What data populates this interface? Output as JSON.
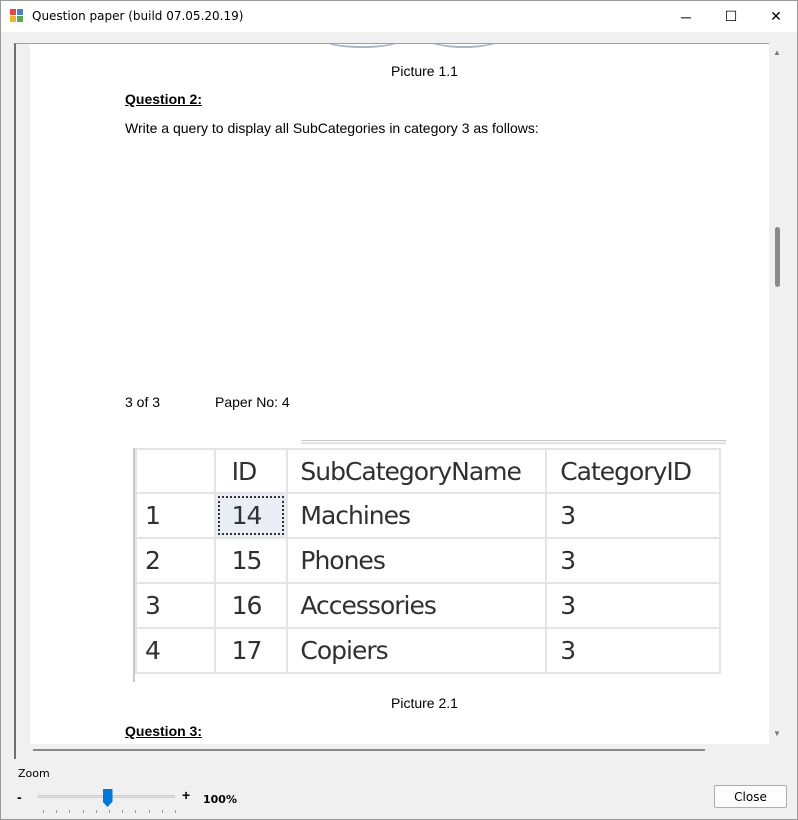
{
  "window": {
    "title": "Question paper (build 07.05.20.19)",
    "minimize_glyph": "─",
    "maximize_glyph": "☐",
    "close_glyph": "✕"
  },
  "document": {
    "picture1_caption": "Picture 1.1",
    "question2_heading": "Question 2:",
    "question2_text": "Write a query to display all SubCategories in category 3 as follows:",
    "page_counter": "3 of 3",
    "paper_no": "Paper No: 4",
    "result_grid": {
      "columns": [
        "",
        "ID",
        "SubCategoryName",
        "CategoryID"
      ],
      "rows": [
        [
          "1",
          "14",
          "Machines",
          "3"
        ],
        [
          "2",
          "15",
          "Phones",
          "3"
        ],
        [
          "3",
          "16",
          "Accessories",
          "3"
        ],
        [
          "4",
          "17",
          "Copiers",
          "3"
        ]
      ]
    },
    "picture2_caption": "Picture 2.1",
    "question3_heading": "Question 3:"
  },
  "zoom": {
    "label": "Zoom",
    "minus": "-",
    "plus": "+",
    "value_text": "100%",
    "slider_fraction": 0.5
  },
  "footer": {
    "close_label": "Close"
  },
  "colors": {
    "accent": "#0078d7",
    "window_bg": "#f0f0f0",
    "page_bg": "#ffffff"
  }
}
